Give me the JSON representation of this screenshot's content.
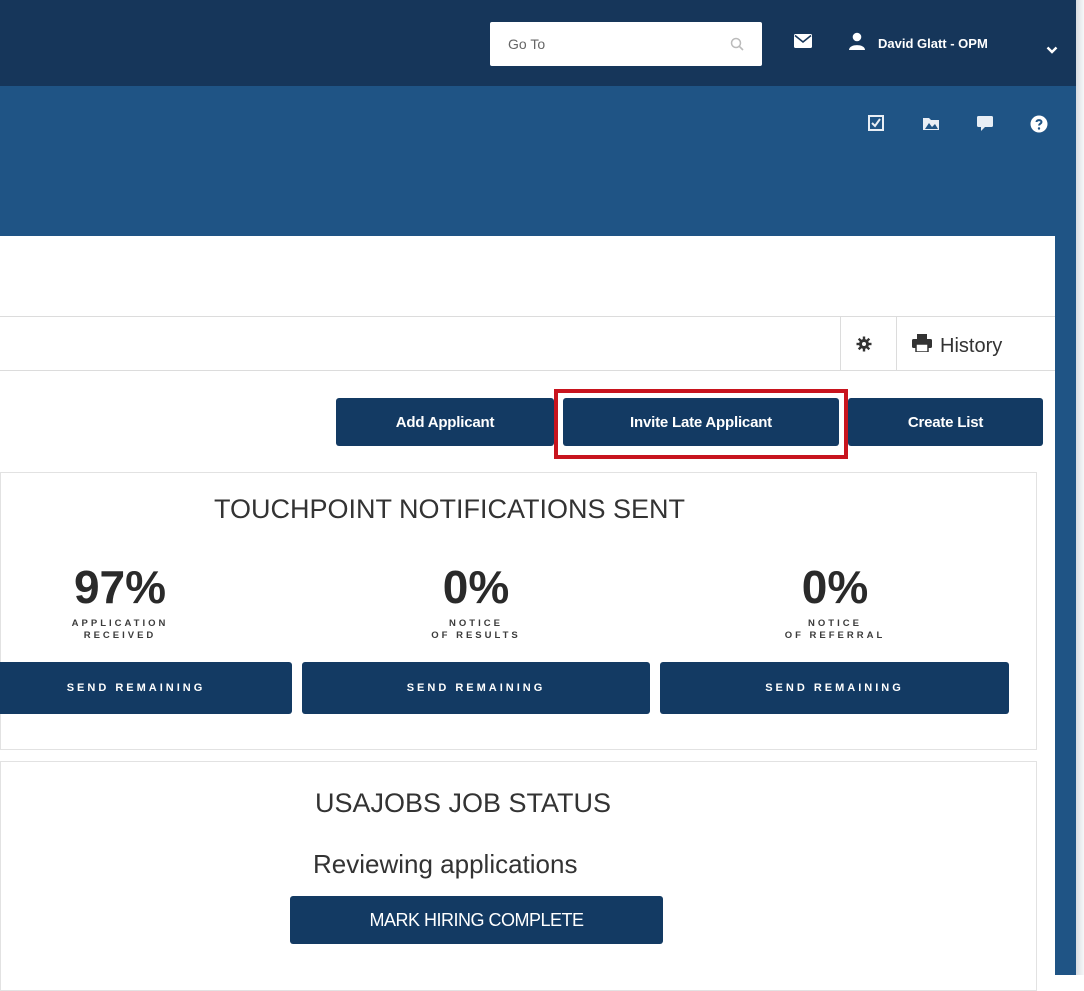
{
  "header": {
    "search_placeholder": "Go To",
    "user_name": "David Glatt - OPM"
  },
  "toolbar": {
    "history_label": "History"
  },
  "actions": {
    "add_applicant": "Add Applicant",
    "invite_late_applicant": "Invite Late Applicant",
    "create_list": "Create List"
  },
  "touchpoints": {
    "title": "TOUCHPOINT NOTIFICATIONS SENT",
    "items": [
      {
        "percent": "97%",
        "caption_line1": "APPLICATION",
        "caption_line2": "RECEIVED",
        "button": "SEND REMAINING"
      },
      {
        "percent": "0%",
        "caption_line1": "NOTICE",
        "caption_line2": "OF RESULTS",
        "button": "SEND REMAINING"
      },
      {
        "percent": "0%",
        "caption_line1": "NOTICE",
        "caption_line2": "OF REFERRAL",
        "button": "SEND REMAINING"
      }
    ]
  },
  "job_status": {
    "title": "USAJOBS JOB STATUS",
    "status": "Reviewing applications",
    "button": "MARK HIRING COMPLETE"
  },
  "colors": {
    "header": "#16365a",
    "subheader": "#1f5485",
    "button": "#133a63",
    "highlight": "#c8141e"
  }
}
